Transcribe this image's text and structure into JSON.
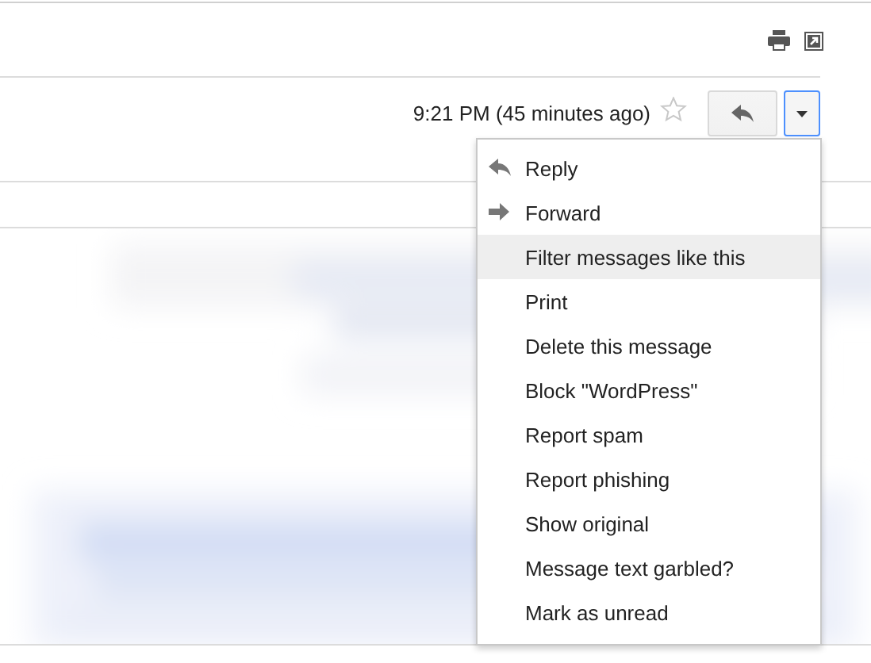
{
  "message": {
    "time": "9:21 PM (45 minutes ago)",
    "starred": false
  },
  "menu": {
    "open": true,
    "items": [
      {
        "label": "Reply",
        "kind": "reply",
        "highlighted": false
      },
      {
        "label": "Forward",
        "kind": "forward",
        "highlighted": false
      },
      {
        "label": "Filter messages like this",
        "kind": "plain",
        "highlighted": true
      },
      {
        "label": "Print",
        "kind": "plain",
        "highlighted": false
      },
      {
        "label": "Delete this message",
        "kind": "plain",
        "highlighted": false
      },
      {
        "label": "Block \"WordPress\"",
        "kind": "plain",
        "highlighted": false
      },
      {
        "label": "Report spam",
        "kind": "plain",
        "highlighted": false
      },
      {
        "label": "Report phishing",
        "kind": "plain",
        "highlighted": false
      },
      {
        "label": "Show original",
        "kind": "plain",
        "highlighted": false
      },
      {
        "label": "Message text garbled?",
        "kind": "plain",
        "highlighted": false
      },
      {
        "label": "Mark as unread",
        "kind": "plain",
        "highlighted": false
      }
    ]
  }
}
